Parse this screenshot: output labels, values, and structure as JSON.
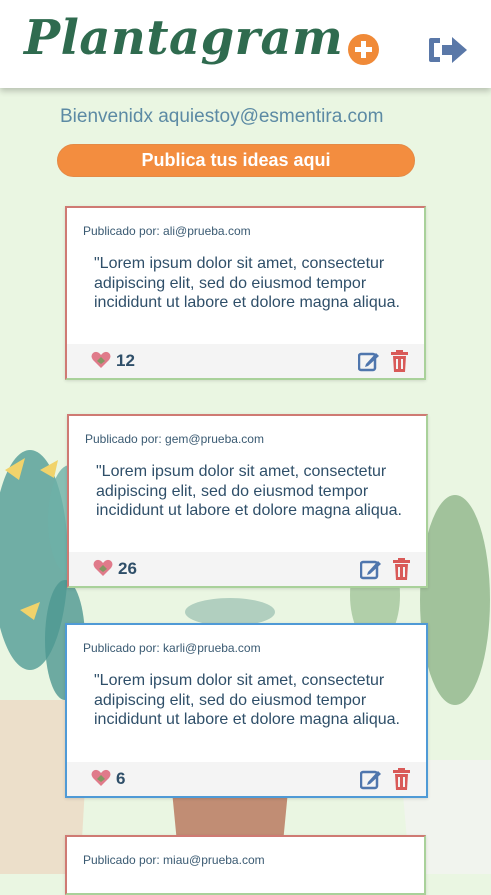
{
  "app": {
    "title": "Plantagram"
  },
  "header": {
    "add_icon": "plus-circle-icon",
    "logout_icon": "sign-out-icon"
  },
  "welcome": "Bienvenidx aquiestoy@esmentira.com",
  "publish_label": "Publica tus ideas aqui",
  "colors": {
    "accent": "#f38d3f",
    "brand": "#2f6b4f",
    "text": "#2f4f69",
    "card_red": "#cf7a73",
    "card_green": "#a9d19a",
    "card_blue": "#4f9ad6"
  },
  "posts": [
    {
      "author": "Publicado por: ali@prueba.com",
      "text": "\"Lorem ipsum dolor sit amet, consectetur adipiscing elit, sed do eiusmod tempor incididunt ut labore et dolore magna aliqua.",
      "likes": "12"
    },
    {
      "author": "Publicado por: gem@prueba.com",
      "text": "\"Lorem ipsum dolor sit amet, consectetur adipiscing elit, sed do eiusmod tempor incididunt ut labore et dolore magna aliqua.",
      "likes": "26"
    },
    {
      "author": "Publicado por: karli@prueba.com",
      "text": "\"Lorem ipsum dolor sit amet, consectetur adipiscing elit, sed do eiusmod tempor incididunt ut labore et dolore magna aliqua.",
      "likes": "6"
    },
    {
      "author": "Publicado por: miau@prueba.com"
    }
  ]
}
